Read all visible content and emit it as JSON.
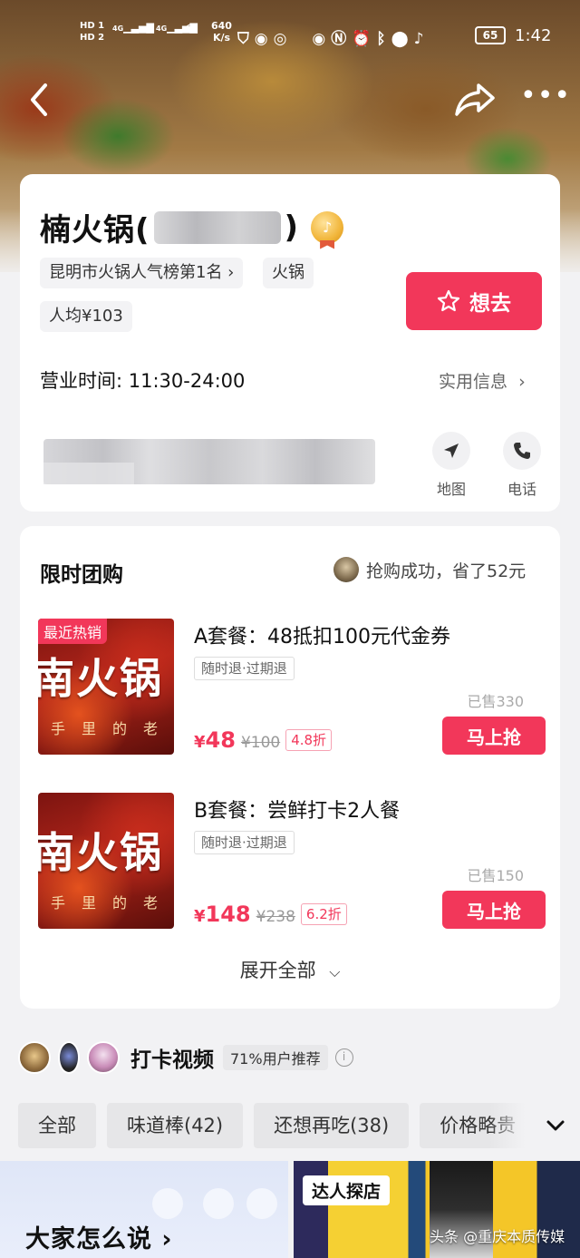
{
  "status_bar": {
    "hd1": "HD 1",
    "hd2": "HD 2",
    "signal1": "4G",
    "signal2": "4G",
    "speed_value": "640",
    "speed_unit": "K/s",
    "battery": "65",
    "time": "1:42"
  },
  "shop": {
    "name": "楠火锅(",
    "name_close": ")",
    "rank_tag": "昆明市火锅人气榜第1名 ›",
    "category_tag": "火锅",
    "avg_price_tag": "人均¥103",
    "want_label": "想去",
    "hours": "营业时间: 11:30-24:00",
    "util_info": "实用信息",
    "map_label": "地图",
    "phone_label": "电话"
  },
  "deals": {
    "title": "限时团购",
    "buyer_note": "抢购成功，省了52元",
    "items": [
      {
        "hot_tag": "最近热销",
        "img_text": "南火锅",
        "img_sub": "手里的老火",
        "name": "A套餐：48抵扣100元代金券",
        "refund": "随时退·过期退",
        "sold": "已售330",
        "price_symbol": "¥",
        "price": "48",
        "orig": "¥100",
        "discount": "4.8折",
        "btn": "马上抢"
      },
      {
        "img_text": "南火锅",
        "img_sub": "手里的老火",
        "name": "B套餐：尝鲜打卡2人餐",
        "refund": "随时退·过期退",
        "sold": "已售150",
        "price_symbol": "¥",
        "price": "148",
        "orig": "¥238",
        "discount": "6.2折",
        "btn": "马上抢"
      }
    ],
    "expand": "展开全部"
  },
  "videos": {
    "title": "打卡视频",
    "recommend": "71%用户推荐",
    "chips": [
      "全部",
      "味道棒(42)",
      "还想再吃(38)",
      "价格略贵"
    ]
  },
  "bottom": {
    "expert_tag": "达人探店",
    "everyone_says": "大家怎么说 ›",
    "watermark": "头条 @重庆本质传媒"
  },
  "colors": {
    "accent": "#f2375a",
    "background": "#f2f2f4"
  }
}
